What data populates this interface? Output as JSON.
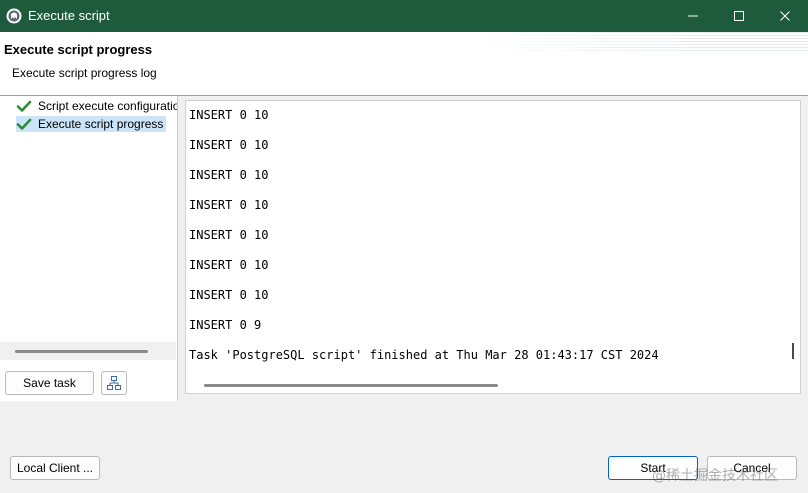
{
  "window": {
    "title": "Execute script"
  },
  "header": {
    "title": "Execute script progress",
    "subtitle": "Execute script progress log"
  },
  "nav": {
    "items": [
      {
        "label": "Script execute configuration",
        "status": "done",
        "selected": false
      },
      {
        "label": "Execute script progress",
        "status": "done",
        "selected": true
      }
    ]
  },
  "left_buttons": {
    "save_task": "Save task"
  },
  "log": {
    "lines": [
      "INSERT 0 10",
      "INSERT 0 10",
      "INSERT 0 10",
      "INSERT 0 10",
      "INSERT 0 10",
      "INSERT 0 10",
      "INSERT 0 10",
      "INSERT 0 9",
      "Task 'PostgreSQL script' finished at Thu Mar 28 01:43:17 CST 2024"
    ]
  },
  "footer": {
    "local_client": "Local Client ...",
    "start": "Start",
    "cancel": "Cancel"
  },
  "watermark": "@稀土掘金技术社区",
  "colors": {
    "titlebar": "#1e5a3c",
    "check": "#2e8b3a",
    "selection": "#cce4f7",
    "primary_border": "#0067c0"
  }
}
